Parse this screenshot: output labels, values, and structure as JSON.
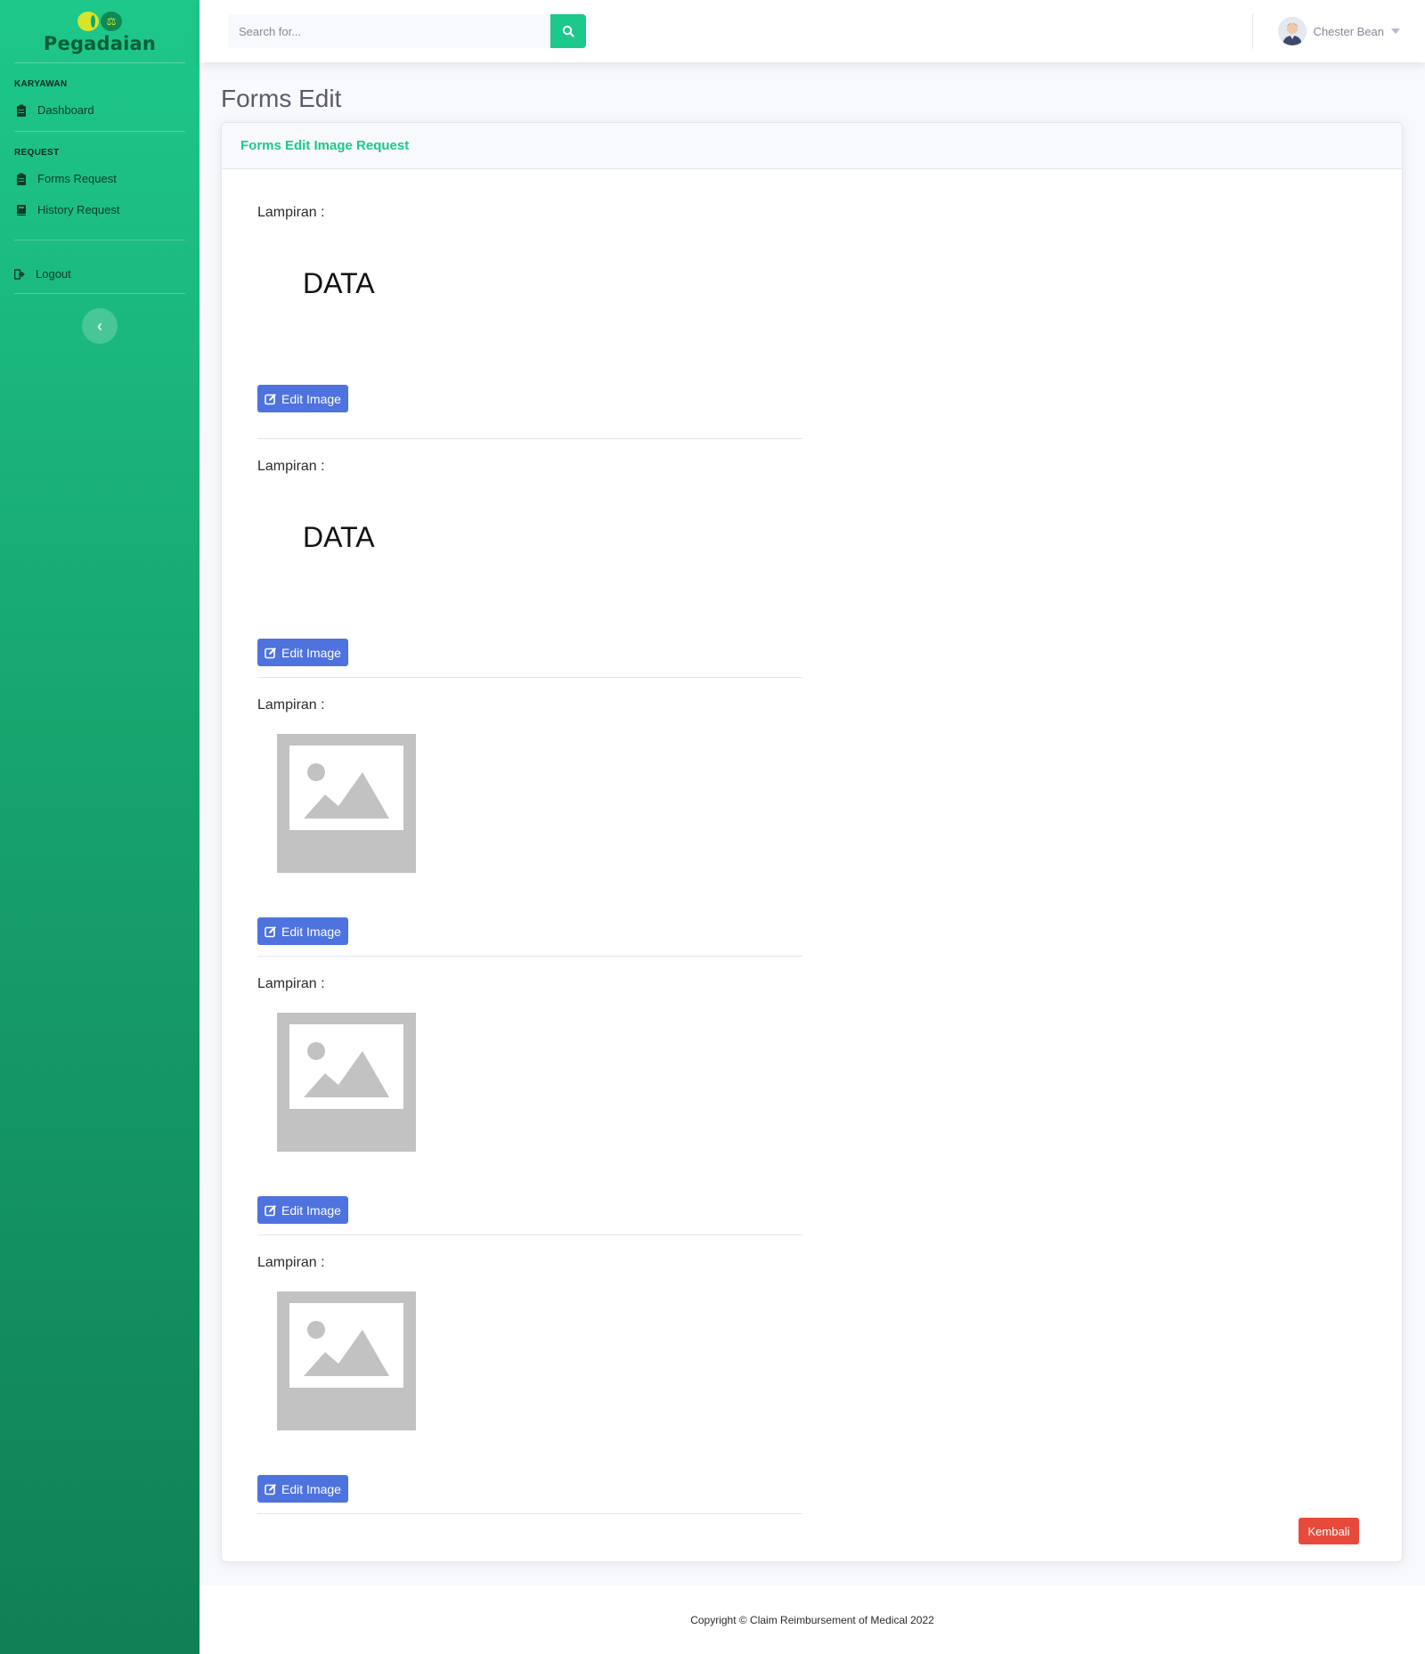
{
  "brand": {
    "name": "Pegadaian"
  },
  "sidebar": {
    "sections": [
      {
        "heading": "KARYAWAN",
        "items": [
          {
            "label": "Dashboard",
            "icon": "clipboard-icon"
          }
        ]
      },
      {
        "heading": "REQUEST",
        "items": [
          {
            "label": "Forms Request",
            "icon": "clipboard-icon"
          },
          {
            "label": "History Request",
            "icon": "book-icon"
          }
        ]
      }
    ],
    "logout_label": "Logout"
  },
  "topbar": {
    "search_placeholder": "Search for...",
    "user_name": "Chester Bean"
  },
  "page": {
    "title": "Forms Edit",
    "card_title": "Forms Edit Image Request"
  },
  "attachments": [
    {
      "label": "Lampiran :",
      "type": "text",
      "content": "DATA",
      "button": "Edit Image"
    },
    {
      "label": "Lampiran :",
      "type": "text",
      "content": "DATA",
      "button": "Edit Image"
    },
    {
      "label": "Lampiran :",
      "type": "image-placeholder",
      "button": "Edit Image"
    },
    {
      "label": "Lampiran :",
      "type": "image-placeholder",
      "button": "Edit Image"
    },
    {
      "label": "Lampiran :",
      "type": "image-placeholder",
      "button": "Edit Image"
    }
  ],
  "actions": {
    "back_label": "Kembali"
  },
  "footer": {
    "text": "Copyright © Claim Reimbursement of Medical 2022"
  },
  "colors": {
    "primary_green": "#1cc88a",
    "button_blue": "#4e73df",
    "danger_red": "#e74a3b"
  }
}
